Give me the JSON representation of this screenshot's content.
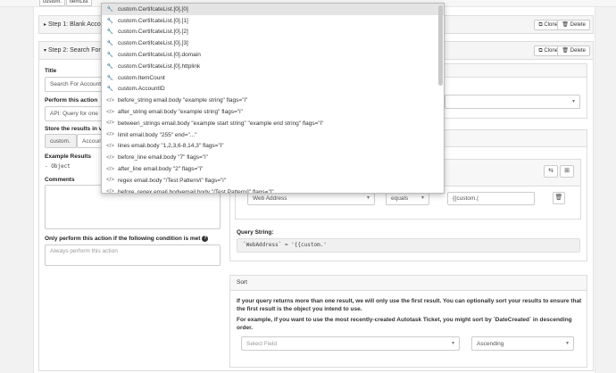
{
  "top_strip": {
    "pill1": "custom.",
    "pill2": "itemList",
    "pill3": "..."
  },
  "step1": {
    "title": "Step 1: Blank Acco",
    "clone": "Clone",
    "delete": "Delete"
  },
  "step2": {
    "title": "Step 2: Search For",
    "clone": "Clone",
    "delete": "Delete"
  },
  "form": {
    "title_label": "Title",
    "title_value": "Search For Account",
    "action_label": "Perform this action",
    "action_value": "API: Query for one",
    "store_label": "Store the results in v",
    "store_prefix": "custom.",
    "store_value": "Account",
    "example_label": "Example Results",
    "example_value": "- Object",
    "comments_label": "Comments",
    "condition_label": "Only perform this action if the following condition is met",
    "condition_placeholder": "Always perform this action"
  },
  "filter": {
    "field": "Web Address",
    "operator": "equals",
    "value": "{{custom.|"
  },
  "query": {
    "label": "Query String:",
    "value": "`WebAddress` = '{{custom.'"
  },
  "sort": {
    "title": "Sort",
    "para1": "If your query returns more than one result, we will only use the first result. You can optionally sort your results to ensure that the first result is the object you intend to use.",
    "para2": "For example, if you want to use the most recently-created Autotask Ticket, you might sort by `DateCreated` in descending order.",
    "field_placeholder": "Select Field",
    "order_value": "Ascending"
  },
  "dropdown_items": [
    {
      "icon": "wrench-icon",
      "text": "custom.CertifcateList.[0].[0]",
      "highlighted": true
    },
    {
      "icon": "wrench-icon",
      "text": "custom.CertifcateList.[0].[1]"
    },
    {
      "icon": "wrench-icon",
      "text": "custom.CertifcateList.[0].[2]"
    },
    {
      "icon": "wrench-icon",
      "text": "custom.CertifcateList.[0].[3]"
    },
    {
      "icon": "wrench-icon",
      "text": "custom.CertifcateList.[0].domain"
    },
    {
      "icon": "wrench-icon",
      "text": "custom.CertifcateList.[0].httplink"
    },
    {
      "icon": "wrench-icon",
      "text": "custom.ItemCount"
    },
    {
      "icon": "wrench-icon",
      "text": "custom.AccountID"
    },
    {
      "icon": "code-icon",
      "text": "before_string email.body \"example string\" flags=\"i\""
    },
    {
      "icon": "code-icon",
      "text": "after_string email.body \"example string\" flags=\"i\""
    },
    {
      "icon": "code-icon",
      "text": "between_strings email.body \"example start string\" \"example end string\" flags=\"i\""
    },
    {
      "icon": "code-icon",
      "text": "limit email.body \"255\" end=\"...\""
    },
    {
      "icon": "code-icon",
      "text": "lines email.body \"1,2,3,6-8,14,3\" flags=\"i\""
    },
    {
      "icon": "code-icon",
      "text": "before_line email.body \"7\" flags=\"i\""
    },
    {
      "icon": "code-icon",
      "text": "after_line email.body \"2\" flags=\"i\""
    },
    {
      "icon": "code-icon",
      "text": "regex email.body \"/Test Pattern/i\" flags=\"i\""
    },
    {
      "icon": "code-icon",
      "text": "before_regex email.bodyemail.body \"/Test Pattern/i\" flags=\"i\""
    }
  ]
}
